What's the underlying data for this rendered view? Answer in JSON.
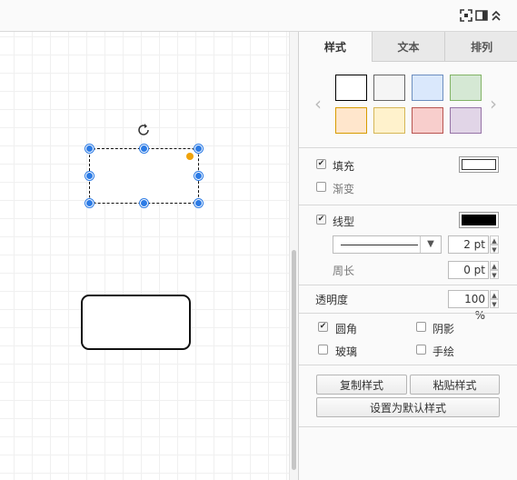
{
  "toolbar": {
    "icons": [
      "fullscreen-icon",
      "format-panel-icon",
      "collapse-icon"
    ]
  },
  "tabs": [
    {
      "label": "样式",
      "active": true
    },
    {
      "label": "文本",
      "active": false
    },
    {
      "label": "排列",
      "active": false
    }
  ],
  "swatches": [
    {
      "fill": "#ffffff",
      "stroke": "#000000"
    },
    {
      "fill": "#f5f5f5",
      "stroke": "#666666"
    },
    {
      "fill": "#dae8fc",
      "stroke": "#6c8ebf"
    },
    {
      "fill": "#d5e8d4",
      "stroke": "#82b366"
    },
    {
      "fill": "#ffe6cc",
      "stroke": "#d79b00"
    },
    {
      "fill": "#fff2cc",
      "stroke": "#d6b656"
    },
    {
      "fill": "#f8cecc",
      "stroke": "#b85450"
    },
    {
      "fill": "#e1d5e7",
      "stroke": "#9673a6"
    }
  ],
  "fill": {
    "label": "填充",
    "checked": true,
    "color": "#ffffff"
  },
  "gradient": {
    "label": "渐变",
    "checked": false
  },
  "line": {
    "label": "线型",
    "checked": true,
    "color": "#000000",
    "width": "2 pt"
  },
  "perimeter": {
    "label": "周长",
    "value": "0 pt"
  },
  "opacity": {
    "label": "透明度",
    "value": "100 %"
  },
  "options": {
    "rounded": {
      "label": "圆角",
      "checked": true
    },
    "shadow": {
      "label": "阴影",
      "checked": false
    },
    "glass": {
      "label": "玻璃",
      "checked": false
    },
    "sketch": {
      "label": "手绘",
      "checked": false
    }
  },
  "buttons": {
    "copy_style": "复制样式",
    "paste_style": "粘贴样式",
    "set_default": "设置为默认样式"
  },
  "colors": {
    "selection": "#2c7be5",
    "orange_handle": "#f0a30a"
  }
}
